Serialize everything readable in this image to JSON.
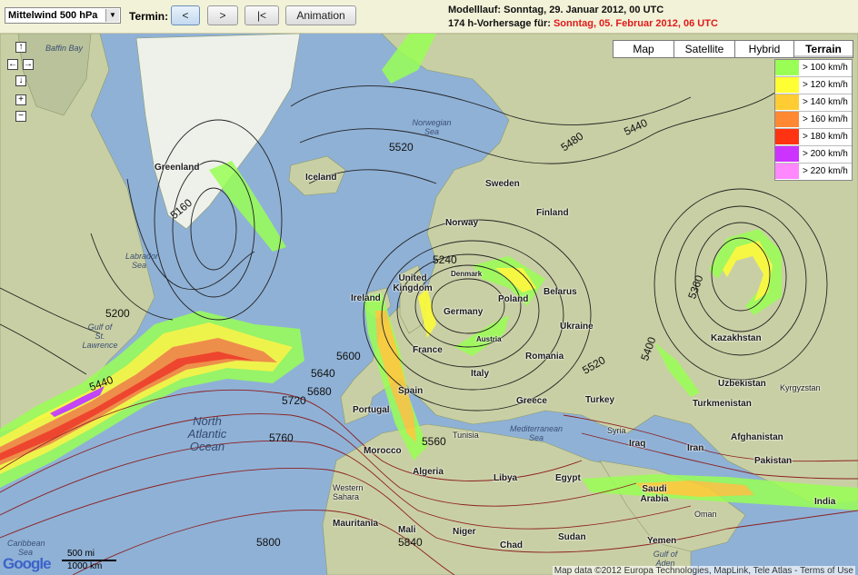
{
  "toolbar": {
    "level_select": "Mittelwind 500 hPa",
    "termin_label": "Termin:",
    "btn_prev": "<",
    "btn_next": ">",
    "btn_first": "|<",
    "btn_animation": "Animation",
    "modelllauf": "Modelllauf: Sonntag, 29. Januar 2012, 00 UTC",
    "forecast_prefix": "174 h-Vorhersage für:",
    "forecast_date": "Sonntag, 05. Februar 2012, 06 UTC"
  },
  "map_types": [
    "Map",
    "Satellite",
    "Hybrid",
    "Terrain"
  ],
  "selected_map_type": "Terrain",
  "legend": [
    {
      "label": "> 100 km/h",
      "color": "#99ff55"
    },
    {
      "label": "> 120 km/h",
      "color": "#ffff33"
    },
    {
      "label": "> 140 km/h",
      "color": "#ffcc33"
    },
    {
      "label": "> 160 km/h",
      "color": "#ff8833"
    },
    {
      "label": "> 180 km/h",
      "color": "#ff3311"
    },
    {
      "label": "> 200 km/h",
      "color": "#cc33ff"
    },
    {
      "label": "> 220 km/h",
      "color": "#ff88ff"
    }
  ],
  "nav": {
    "up": "↑",
    "left": "←",
    "right": "→",
    "down": "↓",
    "zoom_in": "+",
    "zoom_out": "−"
  },
  "countries": {
    "greenland": "Greenland",
    "iceland": "Iceland",
    "sweden": "Sweden",
    "finland": "Finland",
    "norway": "Norway",
    "denmark": "Denmark",
    "united_kingdom": "United Kingdom",
    "ireland": "Ireland",
    "belarus": "Belarus",
    "poland": "Poland",
    "germany": "Germany",
    "ukraine": "Ukraine",
    "france": "France",
    "austria": "Austria",
    "romania": "Romania",
    "italy": "Italy",
    "spain": "Spain",
    "portugal": "Portugal",
    "greece": "Greece",
    "turkey": "Turkey",
    "kazakhstan": "Kazakhstan",
    "uzbekistan": "Uzbekistan",
    "kyrgyzstan": "Kyrgyzstan",
    "turkmenistan": "Turkmenistan",
    "syria": "Syria",
    "iraq": "Iraq",
    "iran": "Iran",
    "afghanistan": "Afghanistan",
    "pakistan": "Pakistan",
    "tunisia": "Tunisia",
    "morocco": "Morocco",
    "algeria": "Algeria",
    "libya": "Libya",
    "egypt": "Egypt",
    "saudi_arabia": "Saudi Arabia",
    "oman": "Oman",
    "india": "India",
    "western_sahara": "Western Sahara",
    "mauritania": "Mauritania",
    "mali": "Mali",
    "niger": "Niger",
    "chad": "Chad",
    "sudan": "Sudan",
    "yemen": "Yemen"
  },
  "seas": {
    "baffin_bay": "Baffin Bay",
    "labrador_sea": "Labrador Sea",
    "norwegian_sea": "Norwegian Sea",
    "gulf_st_lawrence": "Gulf of St. Lawrence",
    "north_atlantic": "North Atlantic Ocean",
    "mediterranean": "Mediterranean Sea",
    "gulf_of_aden": "Gulf of Aden",
    "caribbean": "Caribbean Sea"
  },
  "isohypses": [
    "5520",
    "5480",
    "5440",
    "5160",
    "5240",
    "5200",
    "5440",
    "5600",
    "5640",
    "5680",
    "5720",
    "5760",
    "5560",
    "5520",
    "5360",
    "5400",
    "5800",
    "5840"
  ],
  "scale": {
    "miles": "500 mi",
    "km": "1000 km"
  },
  "google": "Google",
  "copyright": "Map data ©2012 Europa Technologies, MapLink, Tele Atlas - Terms of Use"
}
